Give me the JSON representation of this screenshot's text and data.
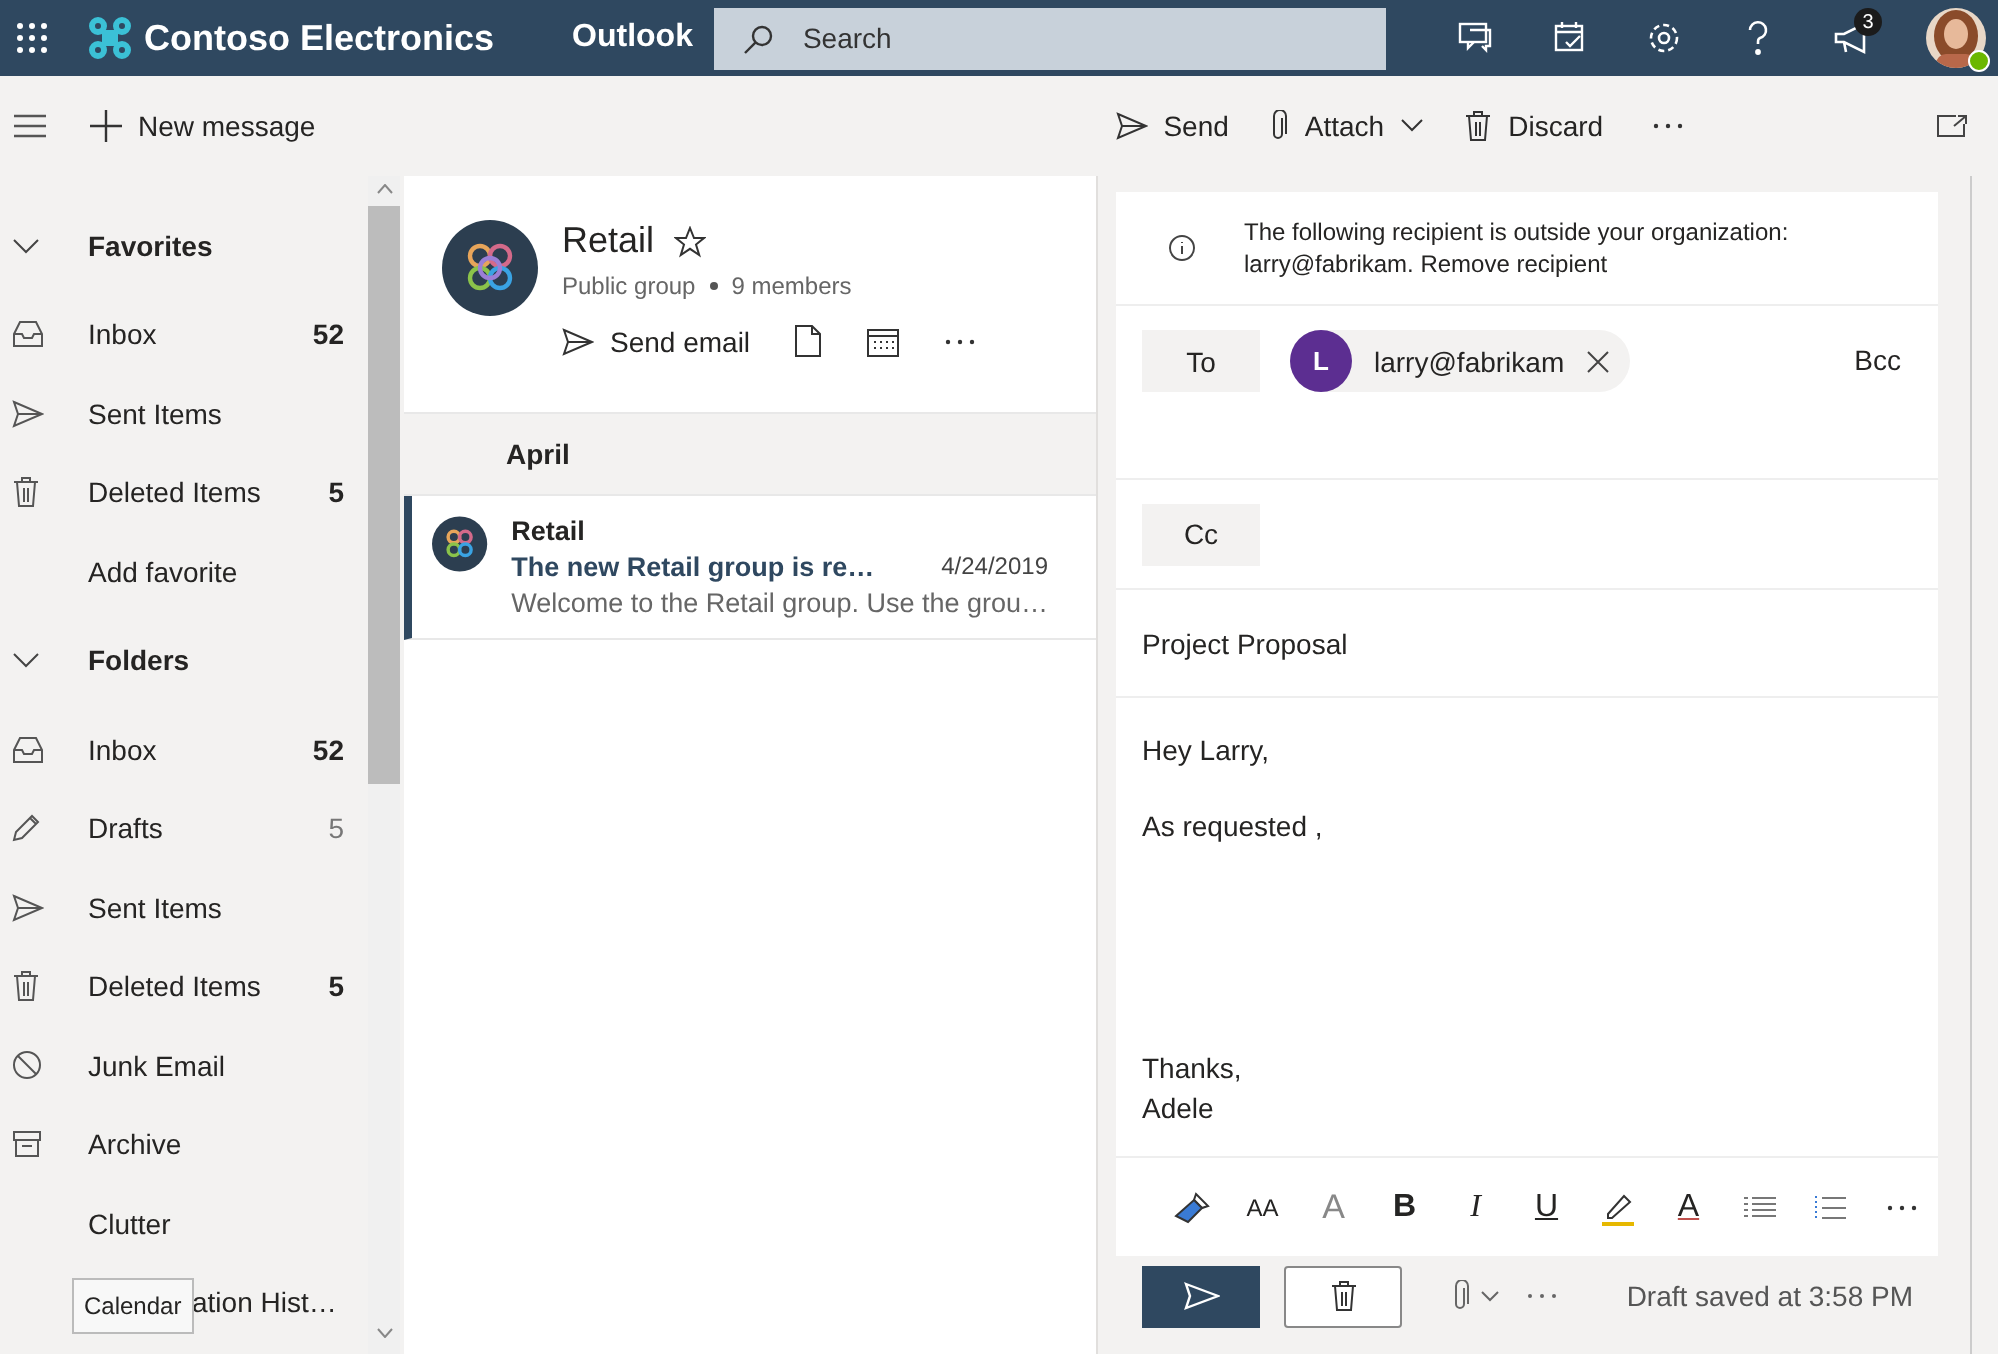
{
  "header": {
    "org": "Contoso Electronics",
    "app": "Outlook",
    "search": {
      "placeholder": "Search"
    },
    "notification_count": "3",
    "avatar": {
      "kind": "picture",
      "online": true
    }
  },
  "command_bar": {
    "new_message": "New message",
    "actions": [
      {
        "label": "Send",
        "kind": "send"
      },
      {
        "label": "Attach",
        "kind": "attach"
      },
      {
        "label": "Discard",
        "kind": "discard"
      }
    ]
  },
  "nav": [
    {
      "kind": "section",
      "label": "Favorites",
      "expanded": true
    },
    {
      "kind": "inbox",
      "label": "Inbox",
      "count": "52",
      "unread": true
    },
    {
      "kind": "sent",
      "label": "Sent Items"
    },
    {
      "kind": "deleted",
      "label": "Deleted Items",
      "count": "5",
      "unread": true
    },
    {
      "kind": "plain",
      "label": "Add favorite"
    },
    {
      "kind": "section",
      "label": "Folders",
      "expanded": true
    },
    {
      "kind": "inbox",
      "label": "Inbox",
      "count": "52",
      "unread": true
    },
    {
      "kind": "drafts",
      "label": "Drafts",
      "count": "5",
      "unread": false
    },
    {
      "kind": "sent",
      "label": "Sent Items"
    },
    {
      "kind": "deleted",
      "label": "Deleted Items",
      "count": "5",
      "unread": true
    },
    {
      "kind": "junk",
      "label": "Junk Email"
    },
    {
      "kind": "archive",
      "label": "Archive"
    },
    {
      "kind": "plain",
      "label": "Clutter"
    },
    {
      "kind": "plain",
      "label": "ation Hist…",
      "tooltip": "Calendar"
    }
  ],
  "group": {
    "name": "Retail",
    "favorite": false,
    "type": "Public group",
    "members": "9 members",
    "send_email": "Send email"
  },
  "messages": [
    {
      "heading": "April"
    },
    {
      "sender": "Retail",
      "subject": "The new Retail group is re…",
      "date": "4/24/2019",
      "preview": "Welcome to the Retail group. Use the grou…",
      "selected": true
    }
  ],
  "compose": {
    "notice": "The following recipient is outside your organization: larry@fabrikam. Remove recipient",
    "to_label": "To",
    "recipient": {
      "initial": "L",
      "address": "larry@fabrikam",
      "color": "#5c2e91"
    },
    "bcc": "Bcc",
    "cc_label": "Cc",
    "subject": "Project Proposal",
    "body": [
      "Hey Larry,",
      "As requested ,"
    ],
    "signoff": [
      "Thanks,",
      "Adele"
    ],
    "format": [
      {
        "kind": "painter"
      },
      {
        "kind": "size",
        "label": "AA"
      },
      {
        "kind": "grow",
        "label": "A"
      },
      {
        "kind": "bold",
        "label": "B"
      },
      {
        "kind": "italic",
        "label": "I"
      },
      {
        "kind": "underline",
        "label": "U"
      },
      {
        "kind": "highlight"
      },
      {
        "kind": "color",
        "label": "A"
      },
      {
        "kind": "bullets"
      },
      {
        "kind": "numbers"
      },
      {
        "kind": "more"
      }
    ],
    "status": "Draft saved at 3:58 PM"
  }
}
